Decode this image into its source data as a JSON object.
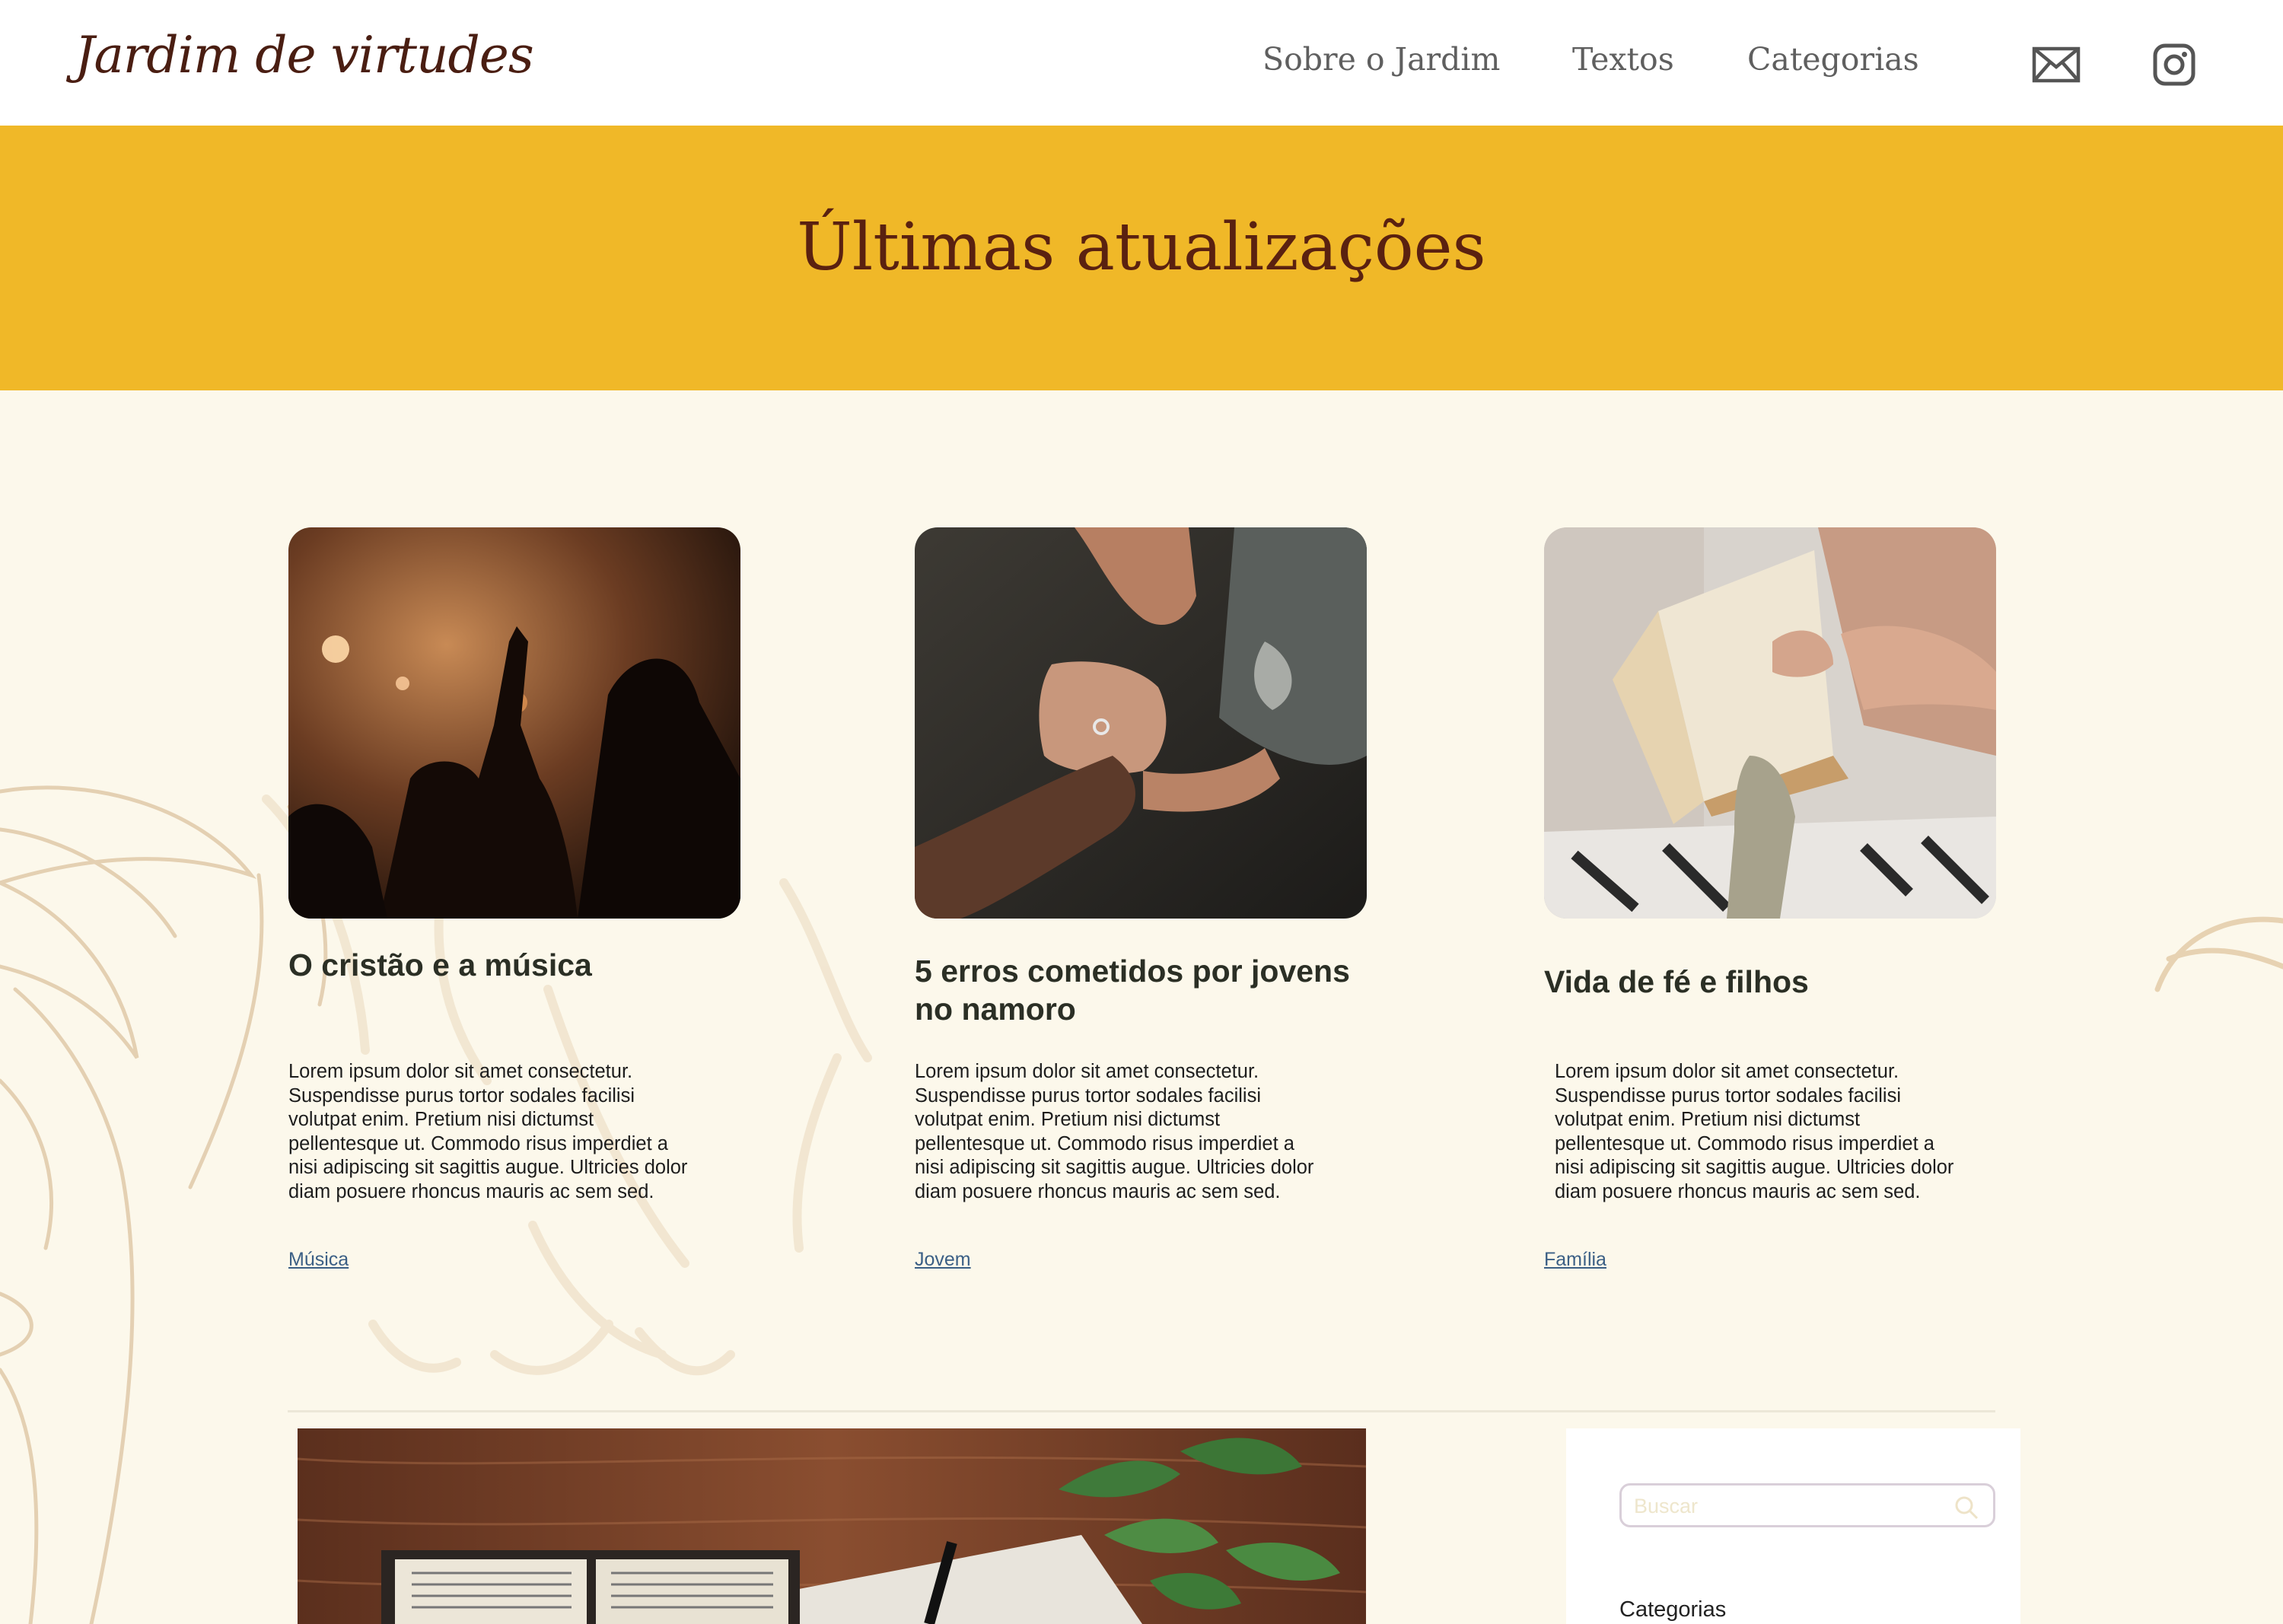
{
  "header": {
    "logo": "Jardim de virtudes",
    "nav": [
      "Sobre o Jardim",
      "Textos",
      "Categorias"
    ],
    "icons": [
      "mail-icon",
      "instagram-icon"
    ]
  },
  "hero": {
    "title": "Últimas atualizações",
    "background": "#f0b828",
    "title_color": "#5a2110"
  },
  "posts": [
    {
      "title": "O cristão e a música",
      "excerpt": "Lorem ipsum dolor sit amet consectetur. Suspendisse purus tortor sodales facilisi volutpat enim. Pretium nisi dictumst pellentesque ut. Commodo risus imperdiet a nisi adipiscing sit sagittis augue. Ultricies dolor diam posuere rhoncus mauris ac sem sed.",
      "category": "Música"
    },
    {
      "title": "5 erros cometidos por jovens no namoro",
      "excerpt": "Lorem ipsum dolor sit amet consectetur. Suspendisse purus tortor sodales facilisi volutpat enim. Pretium nisi dictumst pellentesque ut. Commodo risus imperdiet a nisi adipiscing sit sagittis augue. Ultricies dolor diam posuere rhoncus mauris ac sem sed.",
      "category": "Jovem"
    },
    {
      "title": "Vida de fé e filhos",
      "excerpt": "Lorem ipsum dolor sit amet consectetur. Suspendisse purus tortor sodales facilisi volutpat enim. Pretium nisi dictumst pellentesque ut. Commodo risus imperdiet a nisi adipiscing sit sagittis augue. Ultricies dolor diam posuere rhoncus mauris ac sem sed.",
      "category": "Família"
    }
  ],
  "sidebar": {
    "search_placeholder": "Buscar",
    "categories_heading": "Categorias"
  },
  "colors": {
    "page_background": "#fcf8eb",
    "link": "#3b5f85",
    "decoration": "#dcc3a0"
  }
}
